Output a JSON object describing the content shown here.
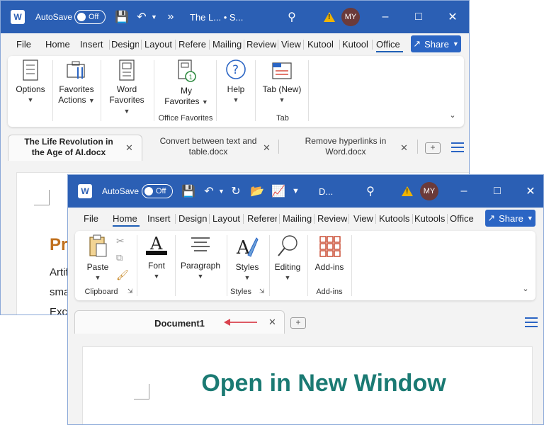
{
  "back": {
    "autosave_label": "AutoSave",
    "autosave_state": "Off",
    "title": "The L... • S...",
    "avatar": "MY",
    "menus": [
      "File",
      "Home",
      "Insert",
      "Design",
      "Layout",
      "Refere",
      "Mailing",
      "Review",
      "View",
      "Kutool",
      "Kutool",
      "Office"
    ],
    "share_label": "Share",
    "ribbon": {
      "options": "Options",
      "favorites_actions": [
        "Favorites",
        "Actions"
      ],
      "word_favorites": [
        "Word",
        "Favorites"
      ],
      "my_favorites": [
        "My",
        "Favorites"
      ],
      "help": "Help",
      "tab_new": "Tab (New)",
      "group_office_favorites": "Office Favorites",
      "group_tab": "Tab"
    },
    "tabs": [
      {
        "label": "The Life Revolution in the Age of AI.docx"
      },
      {
        "label": "Convert between text and table.docx"
      },
      {
        "label": "Remove hyperlinks in Word.docx"
      }
    ],
    "doc_heading_frag": "Pr",
    "doc_lines": [
      "Artif",
      "sma",
      "Exc"
    ]
  },
  "front": {
    "autosave_label": "AutoSave",
    "autosave_state": "Off",
    "title": "D...",
    "avatar": "MY",
    "menus": [
      "File",
      "Home",
      "Insert",
      "Design",
      "Layout",
      "Referer",
      "Mailing",
      "Review",
      "View",
      "Kutools",
      "Kutools",
      "Office"
    ],
    "share_label": "Share",
    "ribbon": {
      "paste": "Paste",
      "font": "Font",
      "paragraph": "Paragraph",
      "styles": "Styles",
      "editing": "Editing",
      "addins": "Add-ins",
      "group_clipboard": "Clipboard",
      "group_styles": "Styles",
      "group_addins": "Add-ins"
    },
    "tab_label": "Document1",
    "doc_text": "Open in New Window"
  },
  "colors": {
    "titlebar": "#2b5fb4",
    "accent": "#1f5fb6",
    "doc_heading": "#c0701e",
    "banner_text": "#1b7a73",
    "arrow": "#d9434f"
  }
}
